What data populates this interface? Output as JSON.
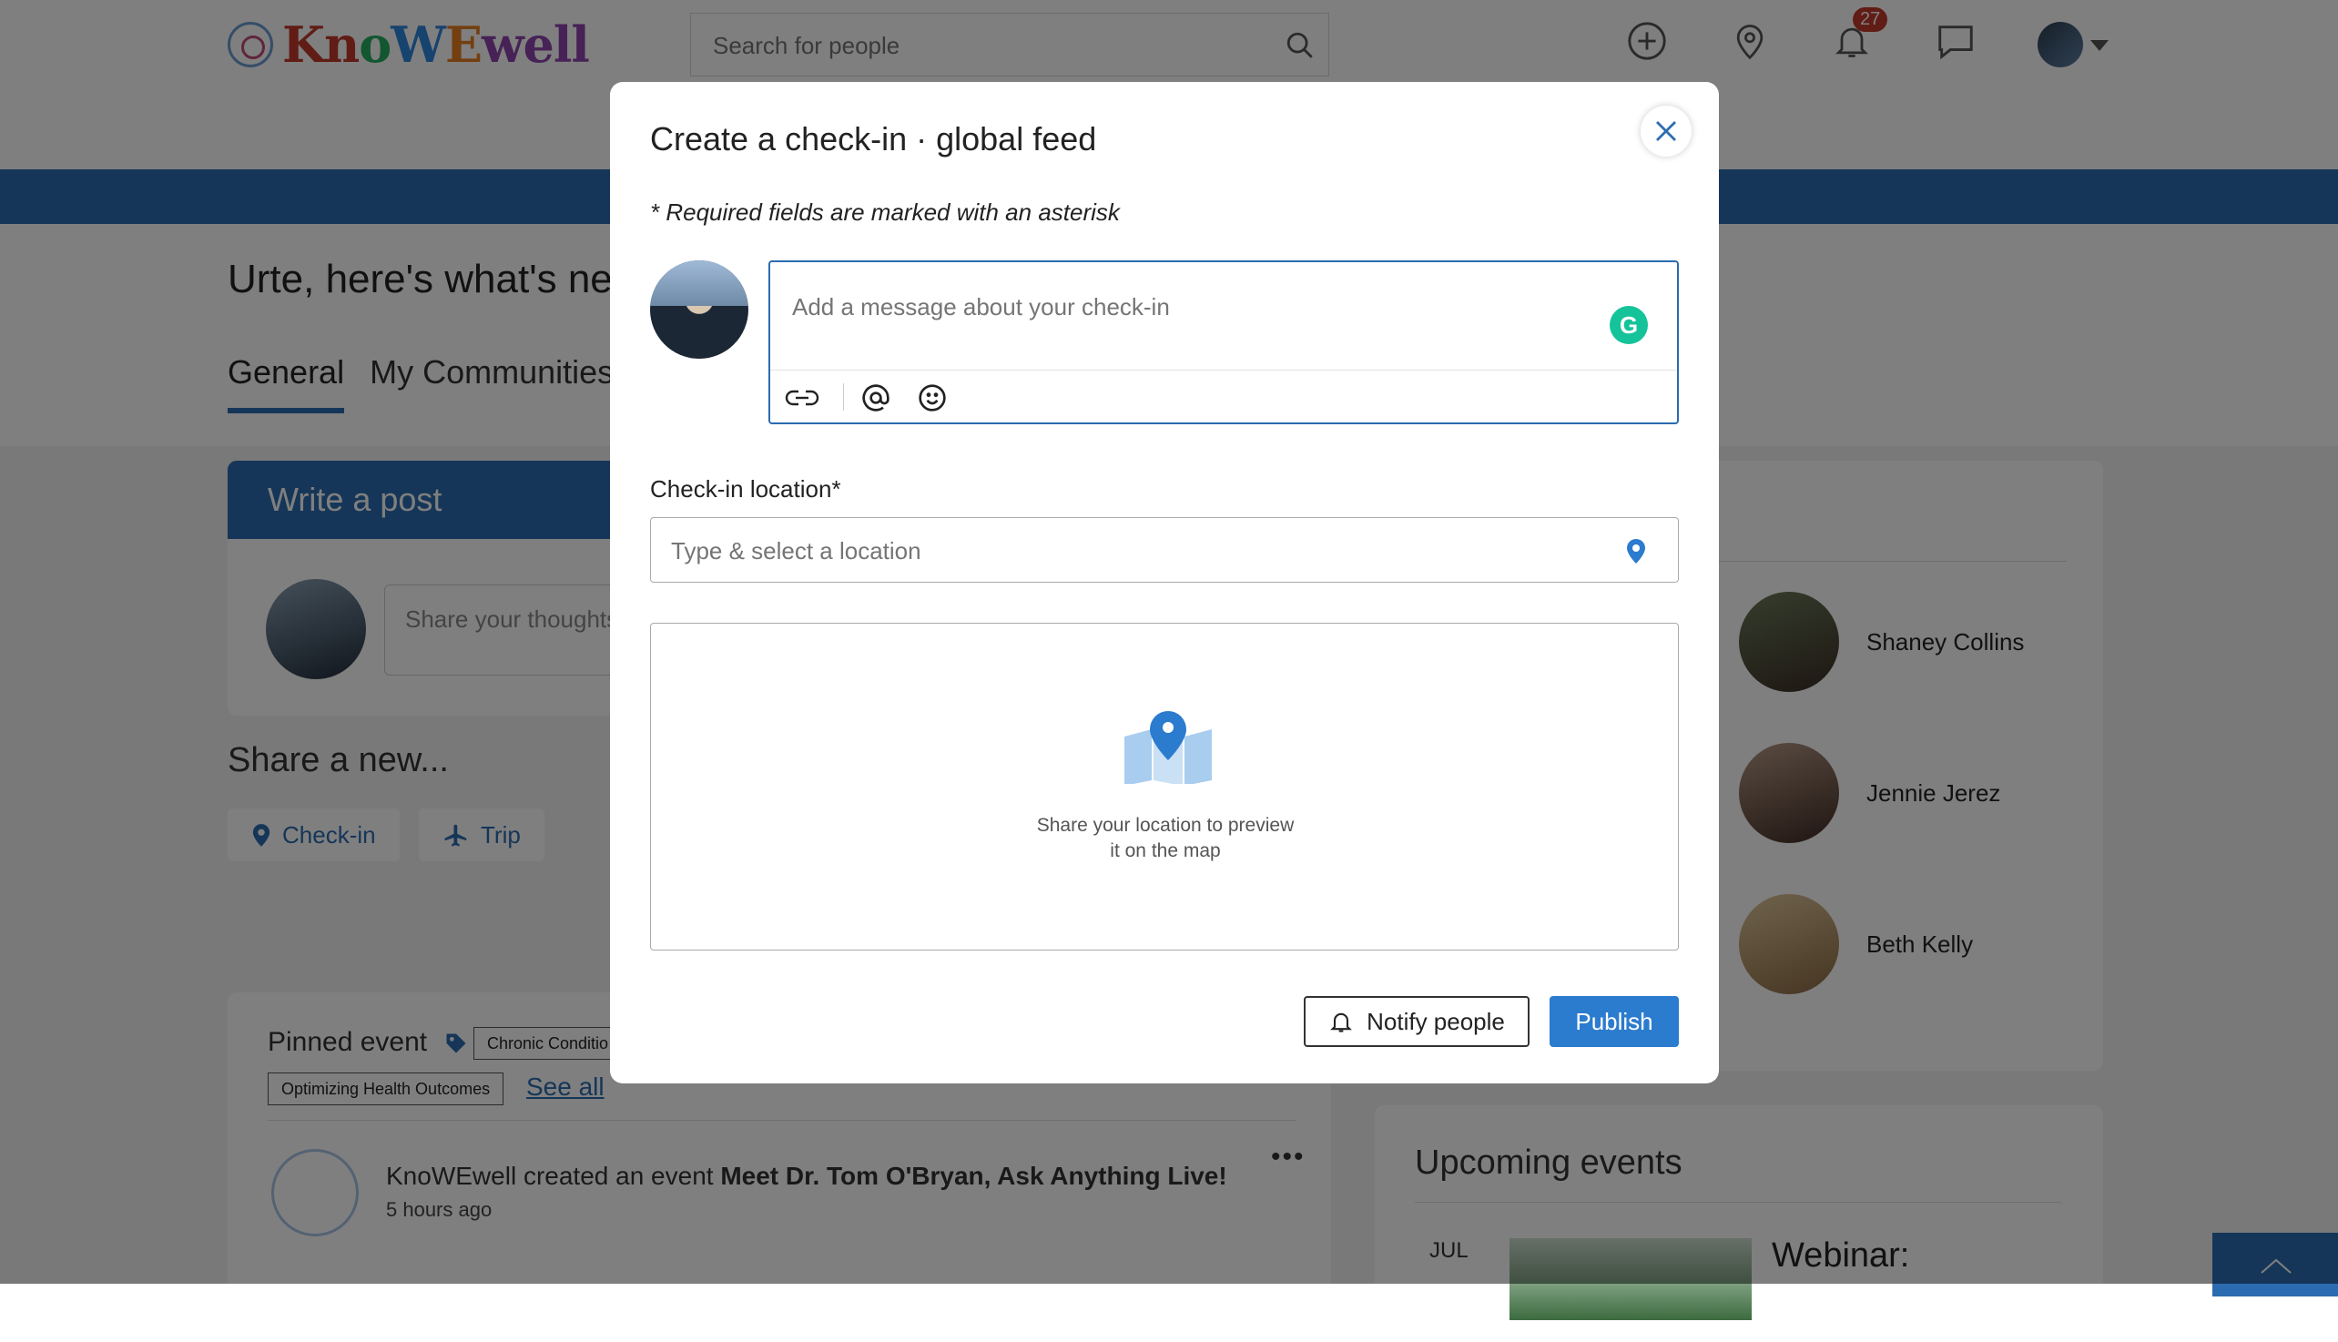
{
  "header": {
    "logo_text": "KnoWEwell",
    "search_placeholder": "Search for people",
    "notifications_count": "27"
  },
  "feed": {
    "greeting": "Urte, here's what's ne",
    "tabs": [
      "General",
      "My Communities"
    ],
    "write_post_title": "Write a post",
    "post_placeholder": "Share your thoughts",
    "share_new_label": "Share a new...",
    "share_options": [
      "Check-in",
      "Trip"
    ]
  },
  "pinned": {
    "title": "Pinned event",
    "tags": [
      "Chronic Conditio",
      "Optimizing Health Outcomes"
    ],
    "see_all": "See all",
    "event_author": "KnoWEwell",
    "event_action": "created an event",
    "event_title": "Meet Dr. Tom O'Bryan, Ask Anything Live!",
    "event_time": "5 hours ago"
  },
  "sidebar": {
    "people": [
      "Shaney Collins",
      "Jennie Jerez",
      "Beth Kelly"
    ],
    "upcoming_title": "Upcoming events",
    "event_month": "JUL",
    "event_title": "Webinar:"
  },
  "modal": {
    "title": "Create a check-in · global feed",
    "required_note": "* Required fields are marked with an asterisk",
    "message_placeholder": "Add a message about your check-in",
    "location_label": "Check-in location",
    "location_required_mark": "*",
    "location_placeholder": "Type & select a location",
    "map_hint_line1": "Share your location to preview",
    "map_hint_line2": "it on the map",
    "notify_label": "Notify people",
    "publish_label": "Publish",
    "grammarly_letter": "G"
  },
  "colors": {
    "brand_blue": "#2b6cb0",
    "publish_blue": "#2b7bce",
    "grammarly_green": "#15c39a",
    "badge_red": "#c0392b"
  }
}
